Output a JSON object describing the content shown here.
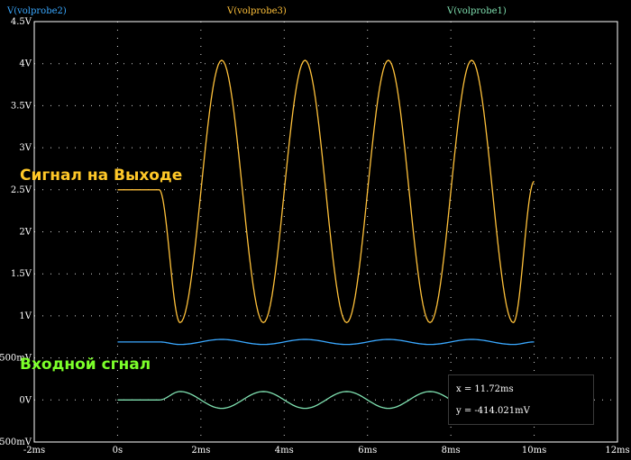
{
  "chart_data": {
    "type": "line",
    "title": "",
    "xlabel": "",
    "ylabel": "",
    "xlim": [
      -2,
      12
    ],
    "ylim": [
      -0.5,
      4.5
    ],
    "x_ticks": [
      {
        "v": -2,
        "label": "-2ms"
      },
      {
        "v": 0,
        "label": "0s"
      },
      {
        "v": 2,
        "label": "2ms"
      },
      {
        "v": 4,
        "label": "4ms"
      },
      {
        "v": 6,
        "label": "6ms"
      },
      {
        "v": 8,
        "label": "8ms"
      },
      {
        "v": 10,
        "label": "10ms"
      },
      {
        "v": 12,
        "label": "12ms"
      }
    ],
    "y_ticks": [
      {
        "v": -0.5,
        "label": "-500mV"
      },
      {
        "v": 0,
        "label": "0V"
      },
      {
        "v": 0.5,
        "label": "500mV"
      },
      {
        "v": 1,
        "label": "1V"
      },
      {
        "v": 1.5,
        "label": "1.5V"
      },
      {
        "v": 2,
        "label": "2V"
      },
      {
        "v": 2.5,
        "label": "2.5V"
      },
      {
        "v": 3,
        "label": "3V"
      },
      {
        "v": 3.5,
        "label": "3.5V"
      },
      {
        "v": 4,
        "label": "4V"
      },
      {
        "v": 4.5,
        "label": "4.5V"
      }
    ],
    "grid": true,
    "legend_position": "top",
    "series": [
      {
        "name": "V(volprobe2)",
        "color": "#3aa8ff",
        "x": [
          0,
          1,
          1.5,
          2.5,
          3.5,
          4.5,
          5.5,
          6.5,
          7.5,
          8.5,
          9.5,
          10
        ],
        "y": [
          0.69,
          0.69,
          0.66,
          0.72,
          0.66,
          0.72,
          0.66,
          0.72,
          0.66,
          0.72,
          0.66,
          0.69
        ]
      },
      {
        "name": "V(volprobe3)",
        "color": "#ffc13a",
        "x": [
          0,
          1,
          1.5,
          2.5,
          3.5,
          4.5,
          5.5,
          6.5,
          7.5,
          8.5,
          9.5,
          10
        ],
        "y": [
          2.5,
          2.5,
          0.92,
          4.04,
          0.92,
          4.04,
          0.92,
          4.04,
          0.92,
          4.04,
          0.92,
          2.6
        ]
      },
      {
        "name": "V(volprobe1)",
        "color": "#7fe0b0",
        "x": [
          0,
          1,
          1.5,
          2.5,
          3.5,
          4.5,
          5.5,
          6.5,
          7.5,
          8.5,
          9.5,
          10
        ],
        "y": [
          0,
          0,
          0.1,
          -0.1,
          0.1,
          -0.1,
          0.1,
          -0.1,
          0.1,
          -0.1,
          0.1,
          0
        ]
      }
    ],
    "annotations": [
      {
        "text": "Сигнал на Выходе",
        "color": "#ffc828"
      },
      {
        "text": "Входной сгнал",
        "color": "#7cff2a"
      }
    ]
  },
  "cursor": {
    "x_readout": "x = 11.72ms",
    "y_readout": "y = -414.021mV"
  }
}
